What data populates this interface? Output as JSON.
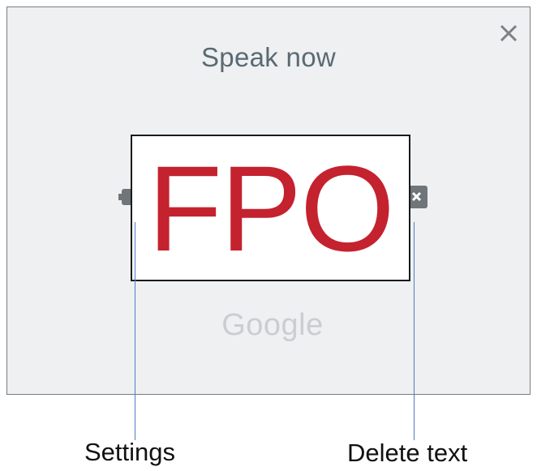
{
  "dialog": {
    "title": "Speak now",
    "brand": "Google",
    "close_icon": "close-icon",
    "settings_icon": "gear-icon",
    "delete_icon": "backspace-icon"
  },
  "placeholder": {
    "text": "FPO",
    "color": "#c4222e"
  },
  "callouts": {
    "settings_label": "Settings",
    "delete_label": "Delete text",
    "line_color": "#4f7ec0"
  }
}
